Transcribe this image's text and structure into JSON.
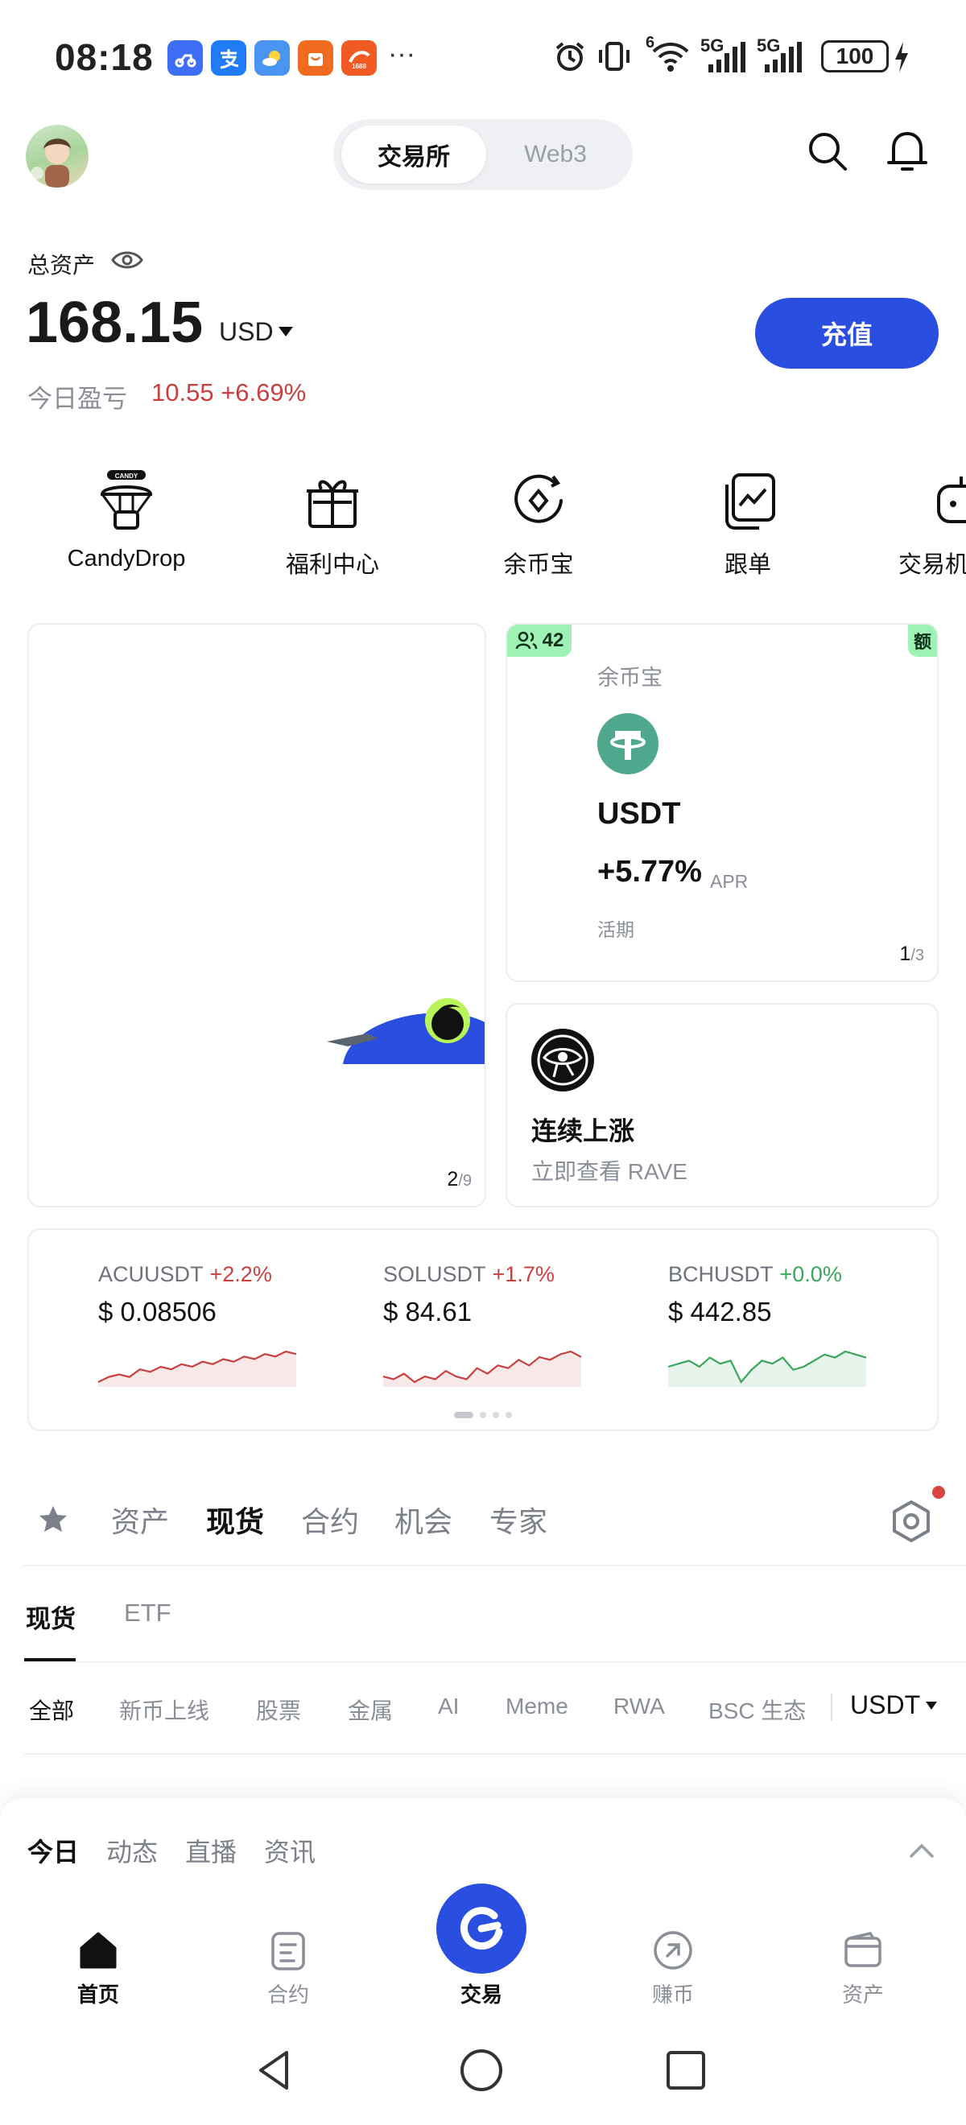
{
  "status_bar": {
    "time": "08:18",
    "more": "···",
    "battery": "100",
    "net1": "5G",
    "net2": "5G",
    "wifi_tag": "6"
  },
  "header": {
    "segment_active": "交易所",
    "segment_inactive": "Web3"
  },
  "assets": {
    "label": "总资产",
    "value": "168.15",
    "currency": "USD",
    "pnl_label": "今日盈亏",
    "pnl_value": "10.55 +6.69%",
    "deposit_label": "充值"
  },
  "quick_actions": [
    {
      "label": "CandyDrop",
      "icon": "candy-parachute-icon"
    },
    {
      "label": "福利中心",
      "icon": "gift-icon"
    },
    {
      "label": "余币宝",
      "icon": "earn-icon"
    },
    {
      "label": "跟单",
      "icon": "copy-trade-icon"
    },
    {
      "label": "交易机",
      "icon": "bot-icon"
    }
  ],
  "banner": {
    "page": "2",
    "total": "/9"
  },
  "earn_card": {
    "users_count": "42",
    "corner_badge": "额",
    "title": "余币宝",
    "coin": "USDT",
    "apr": "+5.77%",
    "apr_unit": "APR",
    "term": "活期",
    "page": "1",
    "total": "/3"
  },
  "rise_card": {
    "title": "连续上涨",
    "subtitle": "立即查看 RAVE"
  },
  "tickers": [
    {
      "name": "ACUUSDT",
      "change": "+2.2%",
      "price": "$ 0.08506",
      "trend": "up",
      "spark": [
        3,
        5,
        6,
        5,
        8,
        7,
        9,
        8,
        10,
        9,
        11,
        10,
        12,
        11,
        13,
        12,
        14,
        13,
        15,
        14
      ]
    },
    {
      "name": "SOLUSDT",
      "change": "+1.7%",
      "price": "$ 84.61",
      "trend": "up",
      "spark": [
        6,
        5,
        7,
        4,
        6,
        5,
        8,
        6,
        5,
        9,
        7,
        10,
        9,
        12,
        10,
        13,
        12,
        14,
        15,
        13
      ]
    },
    {
      "name": "BCHUSDT",
      "change": "+0.0%",
      "price": "$ 442.85",
      "trend": "flat",
      "spark": [
        10,
        11,
        12,
        10,
        13,
        11,
        12,
        5,
        9,
        12,
        11,
        13,
        9,
        10,
        12,
        14,
        13,
        15,
        14,
        13
      ]
    }
  ],
  "colors": {
    "accent": "#2a4fe0",
    "up_red": "#c94040",
    "green": "#3aa55c"
  },
  "market_tabs": [
    "资产",
    "现货",
    "合约",
    "机会",
    "专家"
  ],
  "market_tab_active": "现货",
  "sub_tabs": [
    "现货",
    "ETF"
  ],
  "filters": [
    "全部",
    "新币上线",
    "股票",
    "金属",
    "AI",
    "Meme",
    "RWA",
    "BSC 生态"
  ],
  "quote_currency": "USDT",
  "feed_tabs": [
    "今日",
    "动态",
    "直播",
    "资讯"
  ],
  "bottom_nav": [
    "首页",
    "合约",
    "交易",
    "赚币",
    "资产"
  ]
}
